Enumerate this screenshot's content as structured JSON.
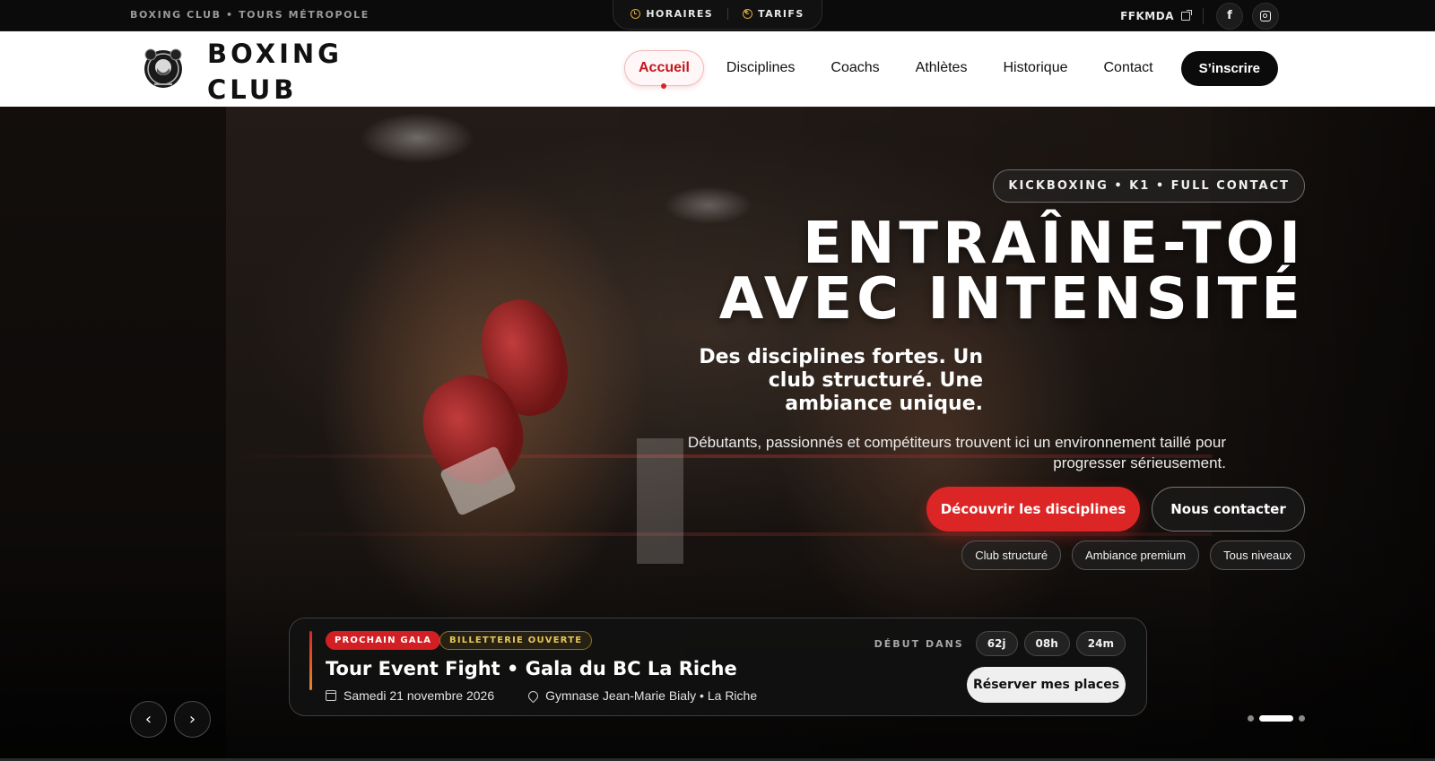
{
  "topbar": {
    "brand_line": "BOXING CLUB • TOURS MÉTROPOLE",
    "links": [
      {
        "label": "HORAIRES",
        "icon": "clock-icon"
      },
      {
        "label": "TARIFS",
        "icon": "euro-coin-icon"
      }
    ],
    "federation": "FFKMDA",
    "social": [
      {
        "name": "facebook",
        "glyph": "f"
      },
      {
        "name": "instagram"
      }
    ]
  },
  "nav": {
    "logo_text_line1": "BOXING",
    "logo_text_line2": "CLUB",
    "items": [
      "Accueil",
      "Disciplines",
      "Coachs",
      "Athlètes",
      "Historique",
      "Contact"
    ],
    "active": "Accueil",
    "cta": "S’inscrire"
  },
  "hero": {
    "tag": "KICKBOXING • K1 • FULL CONTACT",
    "headline_line1": "ENTRAÎNE-TOI",
    "headline_line2": "AVEC INTENSITÉ",
    "subheadline": "Des disciplines fortes. Un club structuré. Une ambiance unique.",
    "lead": "Débutants, passionnés et compétiteurs trouvent ici un environnement taillé pour progresser sérieusement.",
    "primary_cta": "Découvrir les disciplines",
    "secondary_cta": "Nous contacter",
    "chips": [
      "Club structuré",
      "Ambiance premium",
      "Tous niveaux"
    ]
  },
  "event": {
    "badge_primary": "PROCHAIN GALA",
    "badge_secondary": "BILLETTERIE OUVERTE",
    "title": "Tour Event Fight • Gala du BC La Riche",
    "date": "Samedi 21 novembre 2026",
    "venue": "Gymnase Jean-Marie Bialy • La Riche",
    "countdown_label": "DÉBUT DANS",
    "countdown": {
      "days": "62j",
      "hours": "08h",
      "minutes": "24m"
    },
    "cta": "Réserver mes places"
  },
  "carousel": {
    "prev_glyph": "‹",
    "next_glyph": "›",
    "slide_count": 3,
    "active_index": 1
  },
  "colors": {
    "accent_red": "#dc2525",
    "accent_gold": "#d8a73a",
    "nav_active": "#c4161c"
  }
}
